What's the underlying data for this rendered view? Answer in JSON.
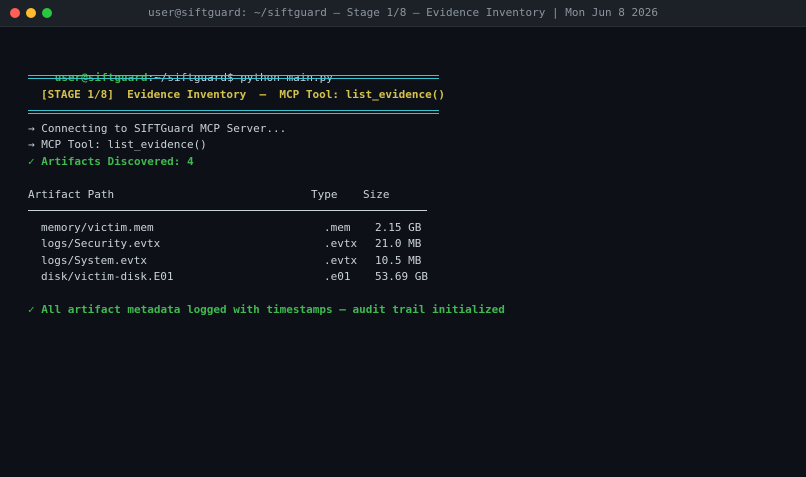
{
  "window": {
    "title": "user@siftguard: ~/siftguard — Stage 1/8 — Evidence Inventory | Mon Jun 8 2026"
  },
  "prompt": {
    "user_host": "user@siftguard",
    "path": ":~/siftguard$",
    "command": "python main.py"
  },
  "banner": {
    "text": "[STAGE 1/8]  Evidence Inventory  —  MCP Tool: list_evidence()"
  },
  "log": {
    "connecting": "→ Connecting to SIFTGuard MCP Server...",
    "tool": "→ MCP Tool: list_evidence()",
    "discovered": "✓ Artifacts Discovered: 4"
  },
  "table": {
    "headers": {
      "path": "Artifact Path",
      "type": "Type",
      "size": "Size"
    },
    "rows": [
      {
        "path": "memory/victim.mem",
        "type": ".mem",
        "size": "2.15 GB"
      },
      {
        "path": "logs/Security.evtx",
        "type": ".evtx",
        "size": "21.0 MB"
      },
      {
        "path": "logs/System.evtx",
        "type": ".evtx",
        "size": "10.5 MB"
      },
      {
        "path": "disk/victim-disk.E01",
        "type": ".e01",
        "size": "53.69 GB"
      }
    ]
  },
  "footer": {
    "message": "✓ All artifact metadata logged with timestamps — audit trail initialized"
  },
  "colors": {
    "background": "#0d1117",
    "prompt_green": "#3fb950",
    "banner_yellow": "#d4c24e",
    "rule_cyan": "#39c5cf",
    "text": "#c9d1d9"
  }
}
